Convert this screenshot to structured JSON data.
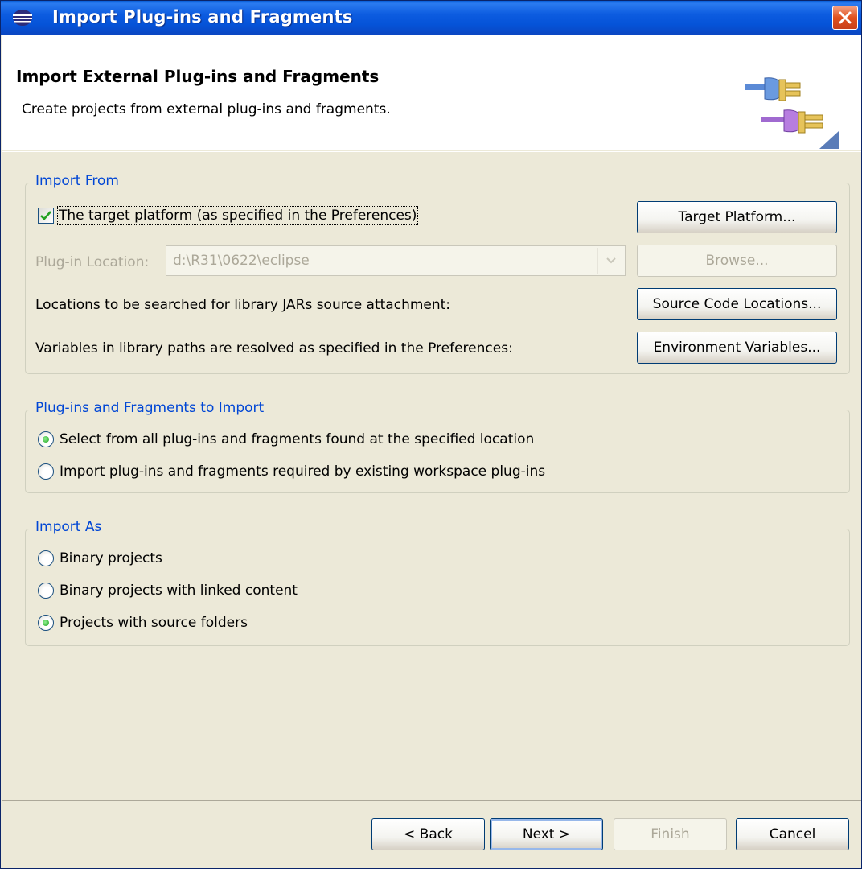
{
  "window": {
    "title": "Import Plug-ins and Fragments"
  },
  "banner": {
    "title": "Import External Plug-ins and Fragments",
    "description": "Create projects from external plug-ins and fragments."
  },
  "import_from": {
    "legend": "Import From",
    "target_platform_checkbox": {
      "label": "The target platform (as specified in the Preferences)",
      "checked": true
    },
    "target_platform_button": "Target Platform...",
    "plugin_location_label": "Plug-in Location:",
    "plugin_location_value": "d:\\R31\\0622\\eclipse",
    "browse_button": "Browse...",
    "source_locations_label": "Locations to be searched for library JARs source attachment:",
    "source_locations_button": "Source Code Locations...",
    "env_vars_label": "Variables in library paths are resolved as specified in the Preferences:",
    "env_vars_button": "Environment Variables..."
  },
  "to_import": {
    "legend": "Plug-ins and Fragments to Import",
    "options": [
      {
        "label": "Select from all plug-ins and fragments found at the specified location",
        "selected": true
      },
      {
        "label": "Import plug-ins and fragments required by existing workspace plug-ins",
        "selected": false
      }
    ]
  },
  "import_as": {
    "legend": "Import As",
    "options": [
      {
        "label": "Binary projects",
        "selected": false
      },
      {
        "label": "Binary projects with linked content",
        "selected": false
      },
      {
        "label": "Projects with source folders",
        "selected": true
      }
    ]
  },
  "footer": {
    "back": "< Back",
    "next": "Next >",
    "finish": "Finish",
    "cancel": "Cancel"
  }
}
